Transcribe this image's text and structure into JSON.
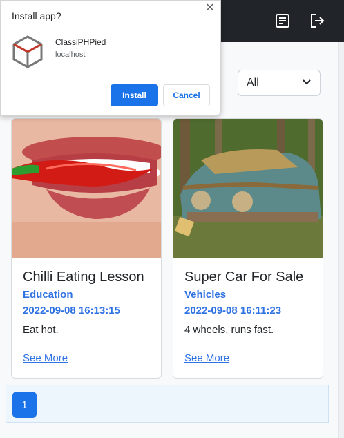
{
  "popup": {
    "title": "Install app?",
    "close_glyph": "✕",
    "app_name": "ClassiPHPied",
    "app_host": "localhost",
    "install_label": "Install",
    "cancel_label": "Cancel",
    "app_icon": "cube-icon"
  },
  "navbar": {
    "icons": [
      "document-icon",
      "logout-icon"
    ]
  },
  "filter": {
    "selected": "All"
  },
  "listings": [
    {
      "title": "Chilli Eating Lesson",
      "category": "Education",
      "date": "2022-09-08 16:13:15",
      "description": "Eat hot.",
      "link": "See More",
      "image": "chilli-in-mouth-photo"
    },
    {
      "title": "Super Car For Sale",
      "category": "Vehicles",
      "date": "2022-09-08 16:11:23",
      "description": "4 wheels, runs fast.",
      "link": "See More",
      "image": "abandoned-car-photo"
    }
  ],
  "pagination": {
    "pages": [
      "1"
    ],
    "current": "1"
  },
  "colors": {
    "navbar": "#212529",
    "accent": "#1a73e8",
    "link": "#2f72e3"
  }
}
